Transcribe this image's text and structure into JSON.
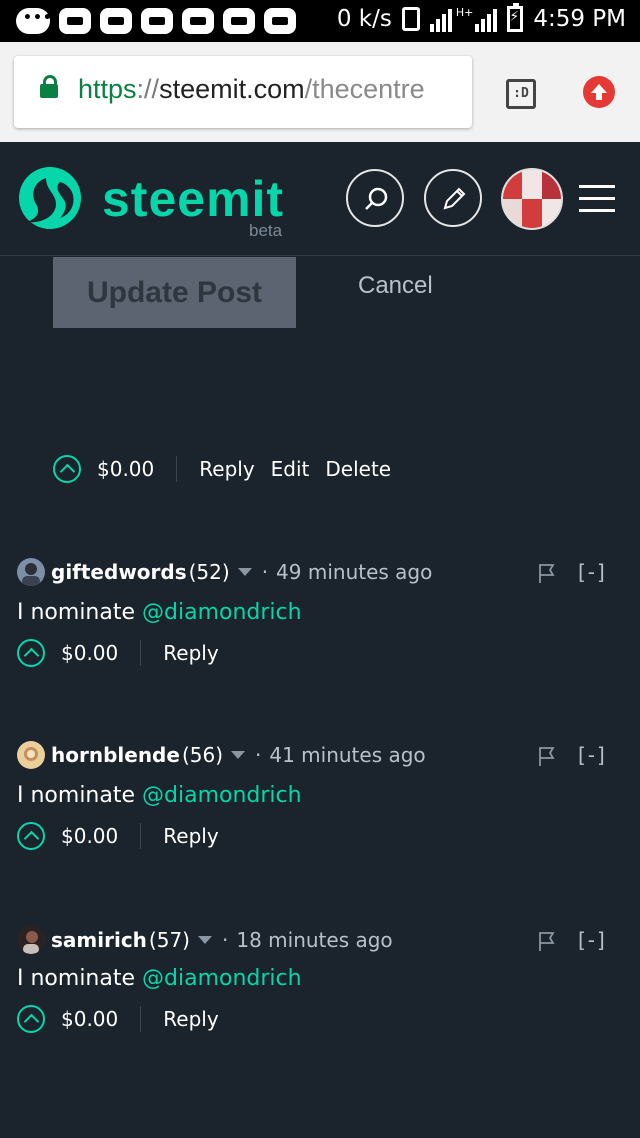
{
  "status_bar": {
    "network_speed": "0 k/s",
    "network_type": "H+",
    "time": "4:59 PM"
  },
  "browser": {
    "url_scheme": "https",
    "url_separator": "://",
    "url_host": "steemit.com",
    "url_path": "/thecentre",
    "tabs_label": ":D"
  },
  "header": {
    "brand": "steemit",
    "badge": "beta"
  },
  "editor": {
    "update_label": "Update Post",
    "cancel_label": "Cancel"
  },
  "own_post_actions": {
    "payout": "$0.00",
    "reply": "Reply",
    "edit": "Edit",
    "delete": "Delete"
  },
  "comments": [
    {
      "author": "giftedwords",
      "reputation": "(52)",
      "dot": "·",
      "time": "49 minutes ago",
      "collapse": "[-]",
      "text": "I nominate ",
      "mention": "@diamondrich",
      "payout": "$0.00",
      "reply": "Reply"
    },
    {
      "author": "hornblende",
      "reputation": "(56)",
      "dot": "·",
      "time": "41 minutes ago",
      "collapse": "[-]",
      "text": "I nominate ",
      "mention": "@diamondrich",
      "payout": "$0.00",
      "reply": "Reply"
    },
    {
      "author": "samirich",
      "reputation": "(57)",
      "dot": "·",
      "time": "18 minutes ago",
      "collapse": "[-]",
      "text": "I nominate ",
      "mention": "@diamondrich",
      "payout": "$0.00",
      "reply": "Reply"
    }
  ],
  "colors": {
    "accent": "#06d6a9",
    "background": "#1b232c",
    "secure_green": "#0b8043"
  }
}
